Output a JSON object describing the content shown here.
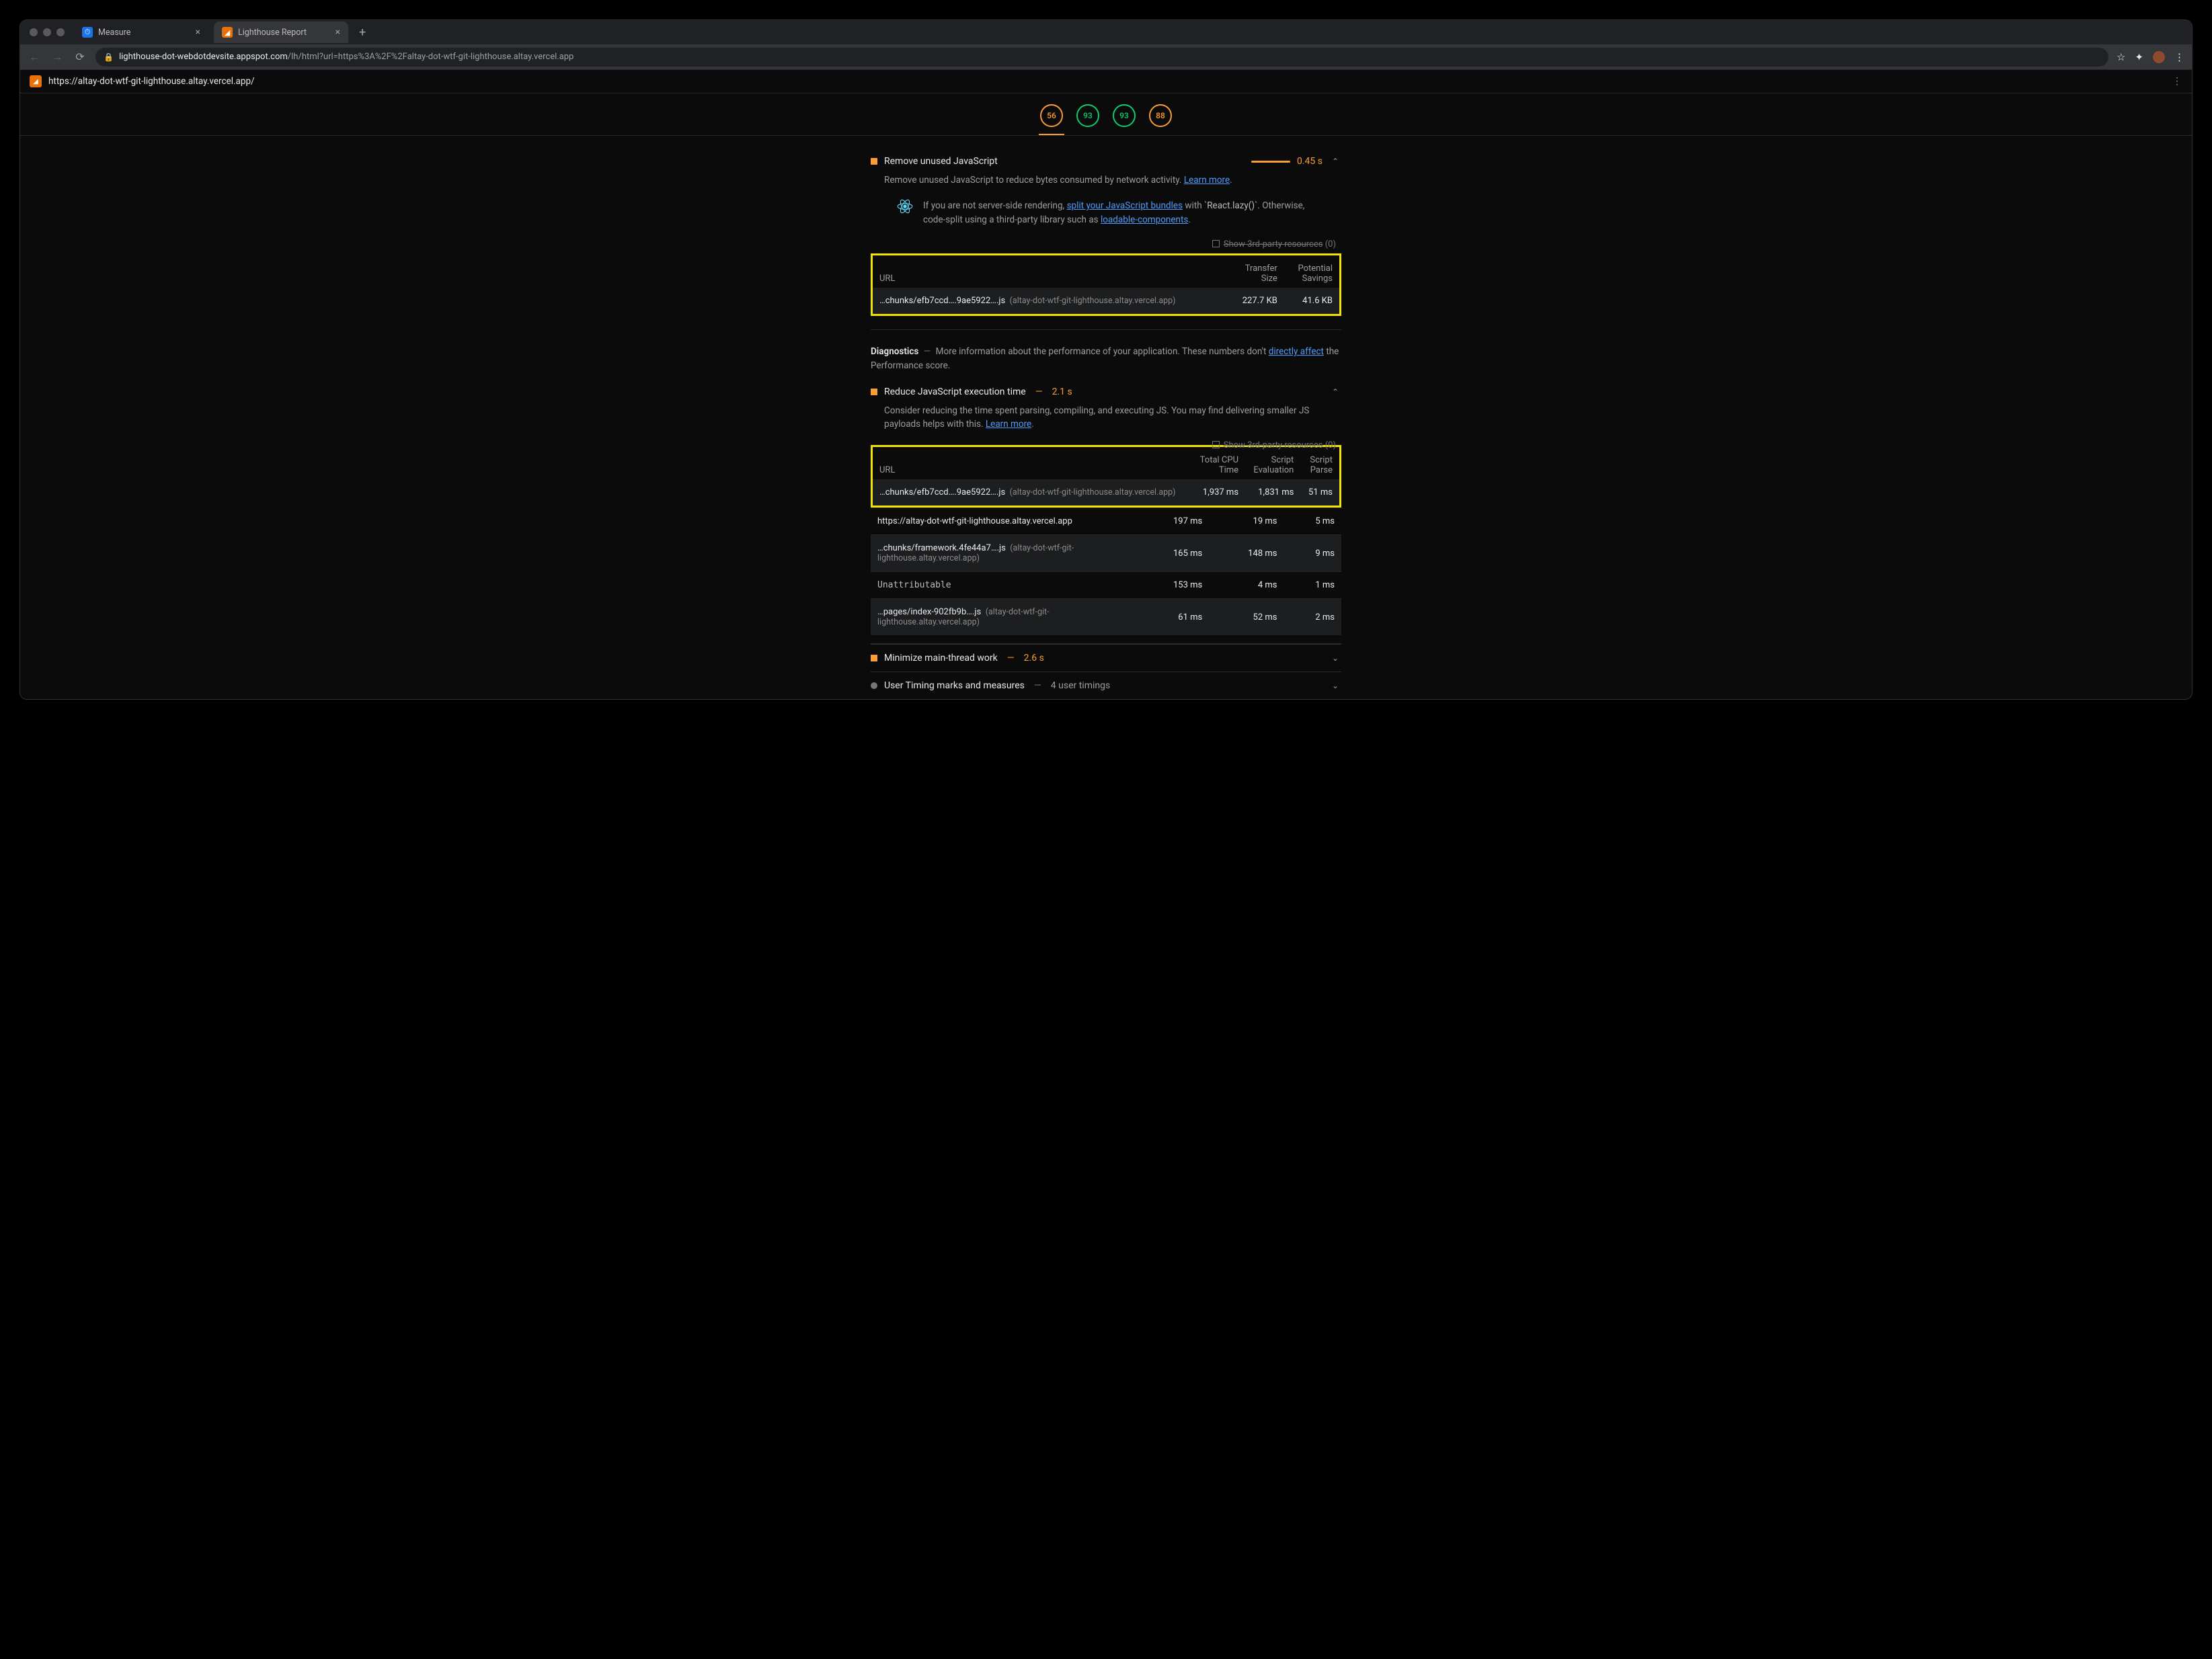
{
  "tabs": [
    {
      "label": "Measure"
    },
    {
      "label": "Lighthouse Report"
    }
  ],
  "omnibox": {
    "host": "lighthouse-dot-webdotdevsite.appspot.com",
    "path": "/lh/html?url=https%3A%2F%2Faltay-dot-wtf-git-lighthouse.altay.vercel.app"
  },
  "page_url": "https://altay-dot-wtf-git-lighthouse.altay.vercel.app/",
  "scores": [
    "56",
    "93",
    "93",
    "88"
  ],
  "audit1": {
    "title": "Remove unused JavaScript",
    "metric": "0.45 s",
    "desc_a": "Remove unused JavaScript to reduce bytes consumed by network activity. ",
    "learn": "Learn more",
    "tip_a": "If you are not server-side rendering, ",
    "tip_link1": "split your JavaScript bundles",
    "tip_b": " with ",
    "tip_code": "`React.lazy()`",
    "tip_c": ". Otherwise, code-split using a third-party library such as ",
    "tip_link2": "loadable-components",
    "third_party": "Show 3rd-party resources",
    "third_party_count": "(0)",
    "cols": {
      "url": "URL",
      "size1": "Transfer",
      "size2": "Size",
      "sav1": "Potential",
      "sav2": "Savings"
    },
    "row": {
      "file": "…chunks/efb7ccd….9ae5922….js",
      "domain": "(altay-dot-wtf-git-lighthouse.altay.vercel.app)",
      "size": "227.7 KB",
      "savings": "41.6 KB"
    }
  },
  "diagnostics": {
    "title": "Diagnostics",
    "desc_a": "More information about the performance of your application. These numbers don't ",
    "link": "directly affect",
    "desc_b": " the Performance score."
  },
  "audit2": {
    "title": "Reduce JavaScript execution time",
    "metric": "2.1 s",
    "desc": "Consider reducing the time spent parsing, compiling, and executing JS. You may find delivering smaller JS payloads helps with this. ",
    "learn": "Learn more",
    "third_party": "Show 3rd-party resources",
    "third_party_count": "(0)",
    "cols": {
      "url": "URL",
      "c1a": "Total CPU",
      "c1b": "Time",
      "c2a": "Script",
      "c2b": "Evaluation",
      "c3a": "Script",
      "c3b": "Parse"
    },
    "rows": [
      {
        "file": "…chunks/efb7ccd….9ae5922….js",
        "domain": "(altay-dot-wtf-git-lighthouse.altay.vercel.app)",
        "c1": "1,937 ms",
        "c2": "1,831 ms",
        "c3": "51 ms",
        "hl": true
      },
      {
        "file": "https://altay-dot-wtf-git-lighthouse.altay.vercel.app",
        "domain": "",
        "c1": "197 ms",
        "c2": "19 ms",
        "c3": "5 ms"
      },
      {
        "file": "…chunks/framework.4fe44a7….js",
        "domain": "(altay-dot-wtf-git-lighthouse.altay.vercel.app)",
        "c1": "165 ms",
        "c2": "148 ms",
        "c3": "9 ms"
      },
      {
        "file": "Unattributable",
        "domain": "",
        "mono": true,
        "c1": "153 ms",
        "c2": "4 ms",
        "c3": "1 ms"
      },
      {
        "file": "…pages/index-902fb9b….js",
        "domain": "(altay-dot-wtf-git-lighthouse.altay.vercel.app)",
        "c1": "61 ms",
        "c2": "52 ms",
        "c3": "2 ms"
      }
    ]
  },
  "audit3": {
    "title": "Minimize main-thread work",
    "metric": "2.6 s"
  },
  "audit4": {
    "title": "User Timing marks and measures",
    "metric": "4 user timings"
  },
  "dash": "—"
}
